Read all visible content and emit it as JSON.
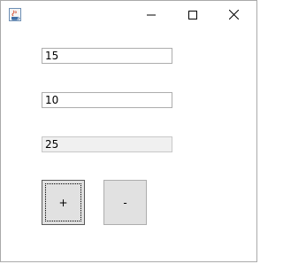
{
  "window": {
    "icon": "java-app-icon",
    "controls": {
      "minimize_icon": "minimize-icon",
      "maximize_icon": "maximize-icon",
      "close_icon": "close-icon"
    }
  },
  "form": {
    "operand_a": "15",
    "operand_b": "10",
    "result": "25"
  },
  "buttons": {
    "add_label": "+",
    "subtract_label": "-"
  },
  "colors": {
    "button_face": "#e1e1e1",
    "readonly_field": "#f0f0f0"
  }
}
